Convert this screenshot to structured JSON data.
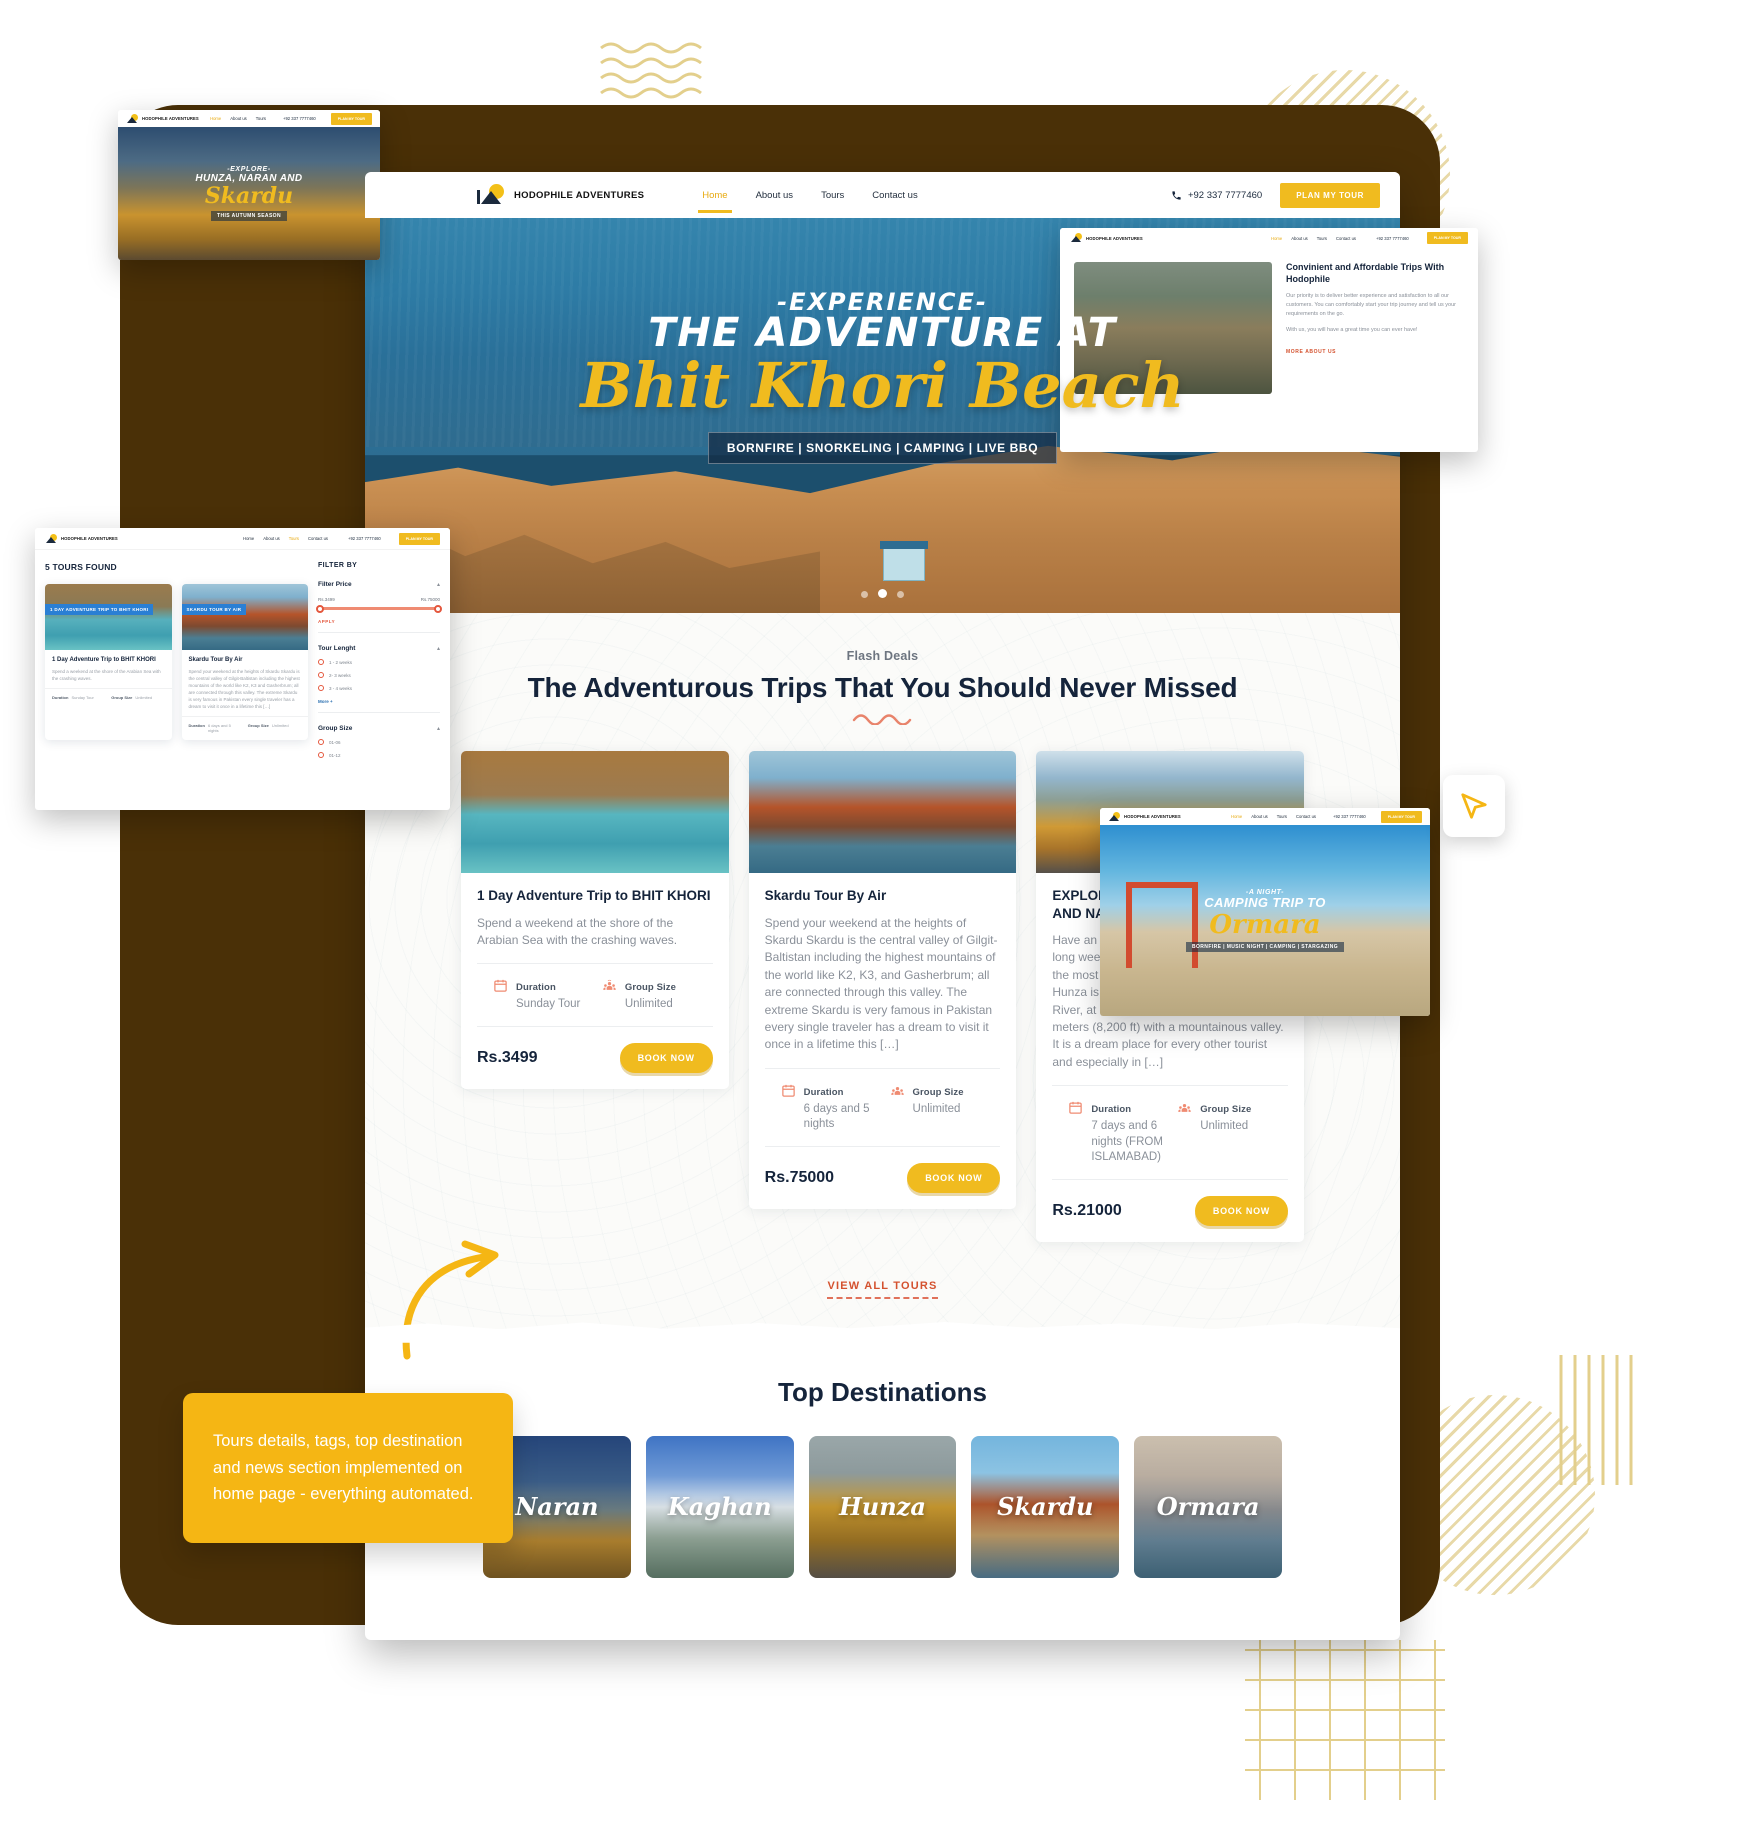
{
  "site": {
    "brand_name": "HODOPHILE ADVENTURES",
    "brand_icon": "tent-sun-logo",
    "phone": "+92 337 7777460",
    "phone_icon": "phone-icon",
    "cta_label": "PLAN MY TOUR",
    "nav": [
      {
        "label": "Home",
        "active": true
      },
      {
        "label": "About us",
        "active": false
      },
      {
        "label": "Tours",
        "active": false
      },
      {
        "label": "Contact us",
        "active": false
      }
    ]
  },
  "hero": {
    "kicker": "-EXPERIENCE-",
    "headline": "THE ADVENTURE AT",
    "script": "Bhit Khori Beach",
    "tags": "BORNFIRE | SNORKELING | CAMPING | LIVE BBQ",
    "slide_count": 3,
    "active_slide": 1
  },
  "deals": {
    "eyebrow": "Flash Deals",
    "title": "The Adventurous Trips That You Should Never Missed",
    "view_all_label": "VIEW ALL TOURS",
    "duration_label": "Duration",
    "group_label": "Group Size",
    "duration_icon": "calendar-icon",
    "group_icon": "group-people-icon",
    "book_label": "BOOK NOW",
    "cards": [
      {
        "title": "1 Day Adventure Trip to BHIT KHORI",
        "desc": "Spend a weekend at the shore of the Arabian Sea with the crashing waves.",
        "duration": "Sunday Tour",
        "group": "Unlimited",
        "price": "Rs.3499"
      },
      {
        "title": "Skardu Tour By Air",
        "desc": "Spend your weekend at the heights of Skardu Skardu is the central valley of Gilgit-Baltistan including the highest mountains of the world like K2, K3, and Gasherbrum; all are connected through this valley. The extreme Skardu is very famous in Pakistan every single traveler has a dream to visit it once in a lifetime this […]",
        "duration": "6 days and 5 nights",
        "group": "Unlimited",
        "price": "Rs.75000"
      },
      {
        "title": "EXPLORE THE BEAUTY OF HUNZA AND NARAN",
        "desc": "Have an adventure of a lifetime that your long weekend stress out. Hunza is one of the most beautiful places in Pakistan. Hunza is situated north/west of the Hunza River, at an elevation of around 2,500 meters (8,200 ft) with a mountainous valley. It is a dream place for every other tourist and especially in […]",
        "duration": "7 days and 6 nights (FROM ISLAMABAD)",
        "group": "Unlimited",
        "price": "Rs.21000"
      }
    ]
  },
  "destinations": {
    "title": "Top Destinations",
    "items": [
      {
        "name": "Naran"
      },
      {
        "name": "Kaghan"
      },
      {
        "name": "Hunza"
      },
      {
        "name": "Skardu"
      },
      {
        "name": "Ormara"
      }
    ]
  },
  "note": {
    "text": "Tours details, tags, top destination and news section implemented on home page - everything automated."
  },
  "mini_hunza": {
    "kicker": "-EXPLORE-",
    "headline": "HUNZA, NARAN AND",
    "script": "Skardu",
    "tag": "THIS AUTUMN SEASON"
  },
  "mini_about": {
    "heading": "Convinient and Affordable Trips With Hodophile",
    "paragraph1": "Our priority is to deliver better experience and satisfaction to all our customers. You can comfortably start your trip journey and tell us your requirements on the go.",
    "paragraph2": "With us, you will have a great time you can ever have!",
    "link": "MORE ABOUT US"
  },
  "mini_tours": {
    "found": "5 TOURS FOUND",
    "filter_title": "FILTER BY",
    "price_filter": {
      "heading": "Filter Price",
      "min": "Rs.3499",
      "max": "Rs.75000",
      "apply": "APPLY"
    },
    "tour_length": {
      "heading": "Tour Lenght",
      "options": [
        "1 - 2 weeks",
        "2- 3 weeks",
        "3 - 4 weeks"
      ],
      "more": "More +"
    },
    "group_size": {
      "heading": "Group Size",
      "options": [
        "01-06",
        "01-12"
      ]
    },
    "cards": [
      {
        "badge": "1 DAY ADVENTURE TRIP TO BHIT KHORI",
        "title": "1 Day Adventure Trip to BHIT KHORI",
        "desc": "Spend a weekend at the shore of the Arabian Sea with the crashing waves.",
        "duration_label": "Duration",
        "duration": "Sunday Tour",
        "group_label": "Group Size",
        "group": "Unlimited"
      },
      {
        "badge": "SKARDU TOUR BY AIR",
        "title": "Skardu Tour By Air",
        "desc": "Spend your weekend at the heights of Skardu Skardu is the central valley of Gilgit-Baltistan including the highest mountains of the world like K2, K3 and Gasherbrum; all are connected through this valley. The extreme Skardu is very famous in Pakistan every single traveler has a dream to visit it once in a lifetime this […]",
        "duration_label": "Duration",
        "duration": "6 days and 5 nights",
        "group_label": "Group Size",
        "group": "Unlimited"
      }
    ]
  },
  "mini_ormara": {
    "kicker": "-A NIGHT-",
    "headline": "CAMPING TRIP TO",
    "script": "Ormara",
    "tag": "BORNFIRE | MUSIC NIGHT | CAMPING | STARGAZING"
  },
  "colors": {
    "brand_yellow": "#f0bb1f",
    "note_yellow": "#f5b614",
    "frame_brown": "#4a3007",
    "heading_navy": "#15243b",
    "accent_red": "#d4522f",
    "muted_gray": "#8a9099"
  }
}
